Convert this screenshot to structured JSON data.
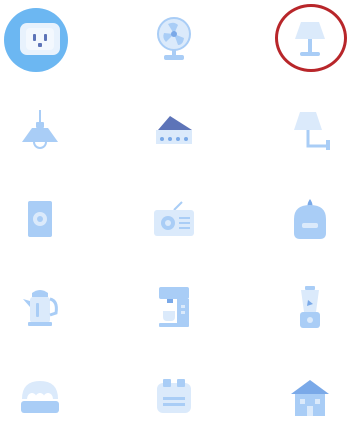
{
  "colors": {
    "selected_bg": "#6cb7f2",
    "selection_ring": "#b8262a",
    "icon_light": "#dbeafb",
    "icon_mid": "#a9cdf6",
    "icon_dark": "#7aa9e8",
    "icon_navy": "#5d74b8"
  },
  "grid": {
    "selected_index": 0,
    "annotated_index": 2,
    "items": [
      {
        "icon": "power-outlet-icon"
      },
      {
        "icon": "desk-fan-icon"
      },
      {
        "icon": "table-lamp-icon"
      },
      {
        "icon": "pendant-lamp-icon"
      },
      {
        "icon": "cheese-slicer-icon"
      },
      {
        "icon": "wall-lamp-icon"
      },
      {
        "icon": "speaker-box-icon"
      },
      {
        "icon": "radio-icon"
      },
      {
        "icon": "humidifier-icon"
      },
      {
        "icon": "kettle-icon"
      },
      {
        "icon": "coffee-machine-icon"
      },
      {
        "icon": "blender-icon"
      },
      {
        "icon": "egg-cooker-icon"
      },
      {
        "icon": "toaster-icon"
      },
      {
        "icon": "house-icon"
      }
    ]
  }
}
